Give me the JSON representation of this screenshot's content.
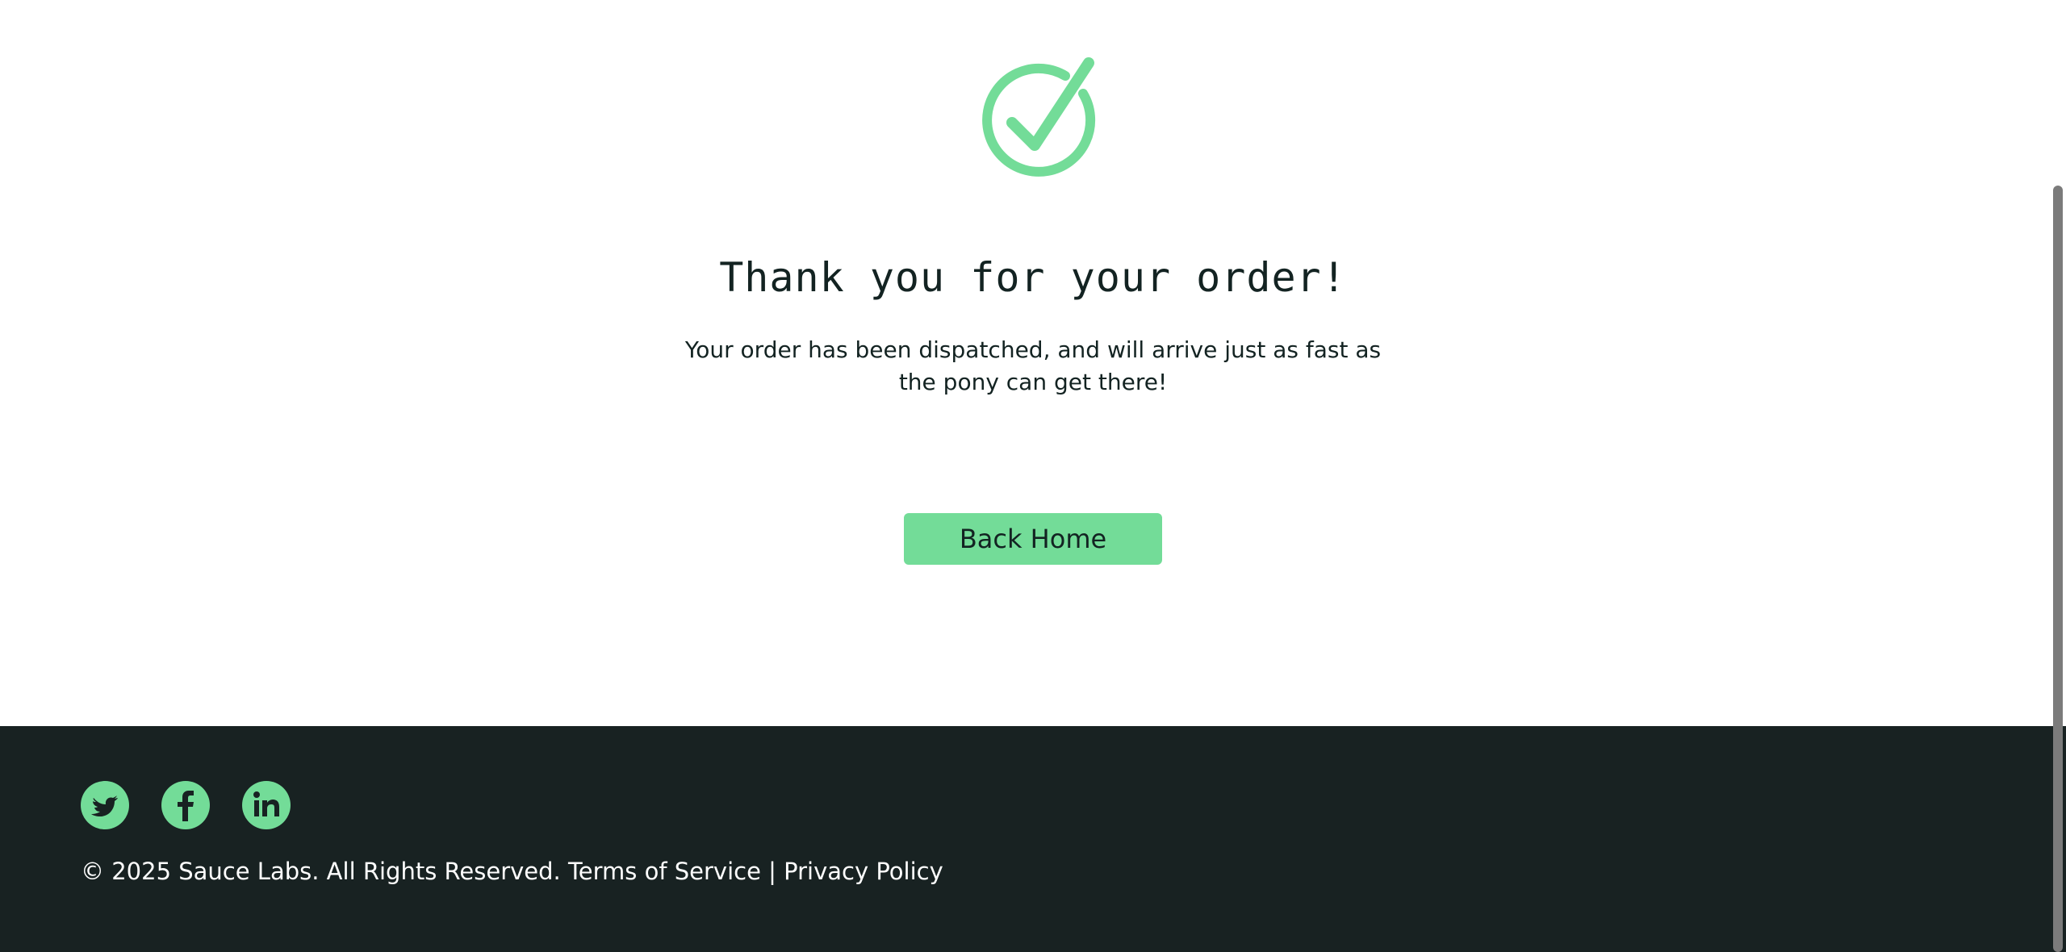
{
  "complete": {
    "header": "Thank you for your order!",
    "text": "Your order has been dispatched, and will arrive just as fast as the pony can get there!",
    "back_home_label": "Back Home",
    "check_icon": "check-circle-icon"
  },
  "footer": {
    "social": [
      {
        "name": "twitter",
        "icon": "twitter-icon"
      },
      {
        "name": "facebook",
        "icon": "facebook-icon"
      },
      {
        "name": "linkedin",
        "icon": "linkedin-icon"
      }
    ],
    "copy": "© 2025 Sauce Labs. All Rights Reserved. Terms of Service | Privacy Policy"
  },
  "colors": {
    "accent": "#73dc98",
    "footer_bg": "#182222",
    "text": "#132322",
    "footer_text": "#ffffff"
  }
}
